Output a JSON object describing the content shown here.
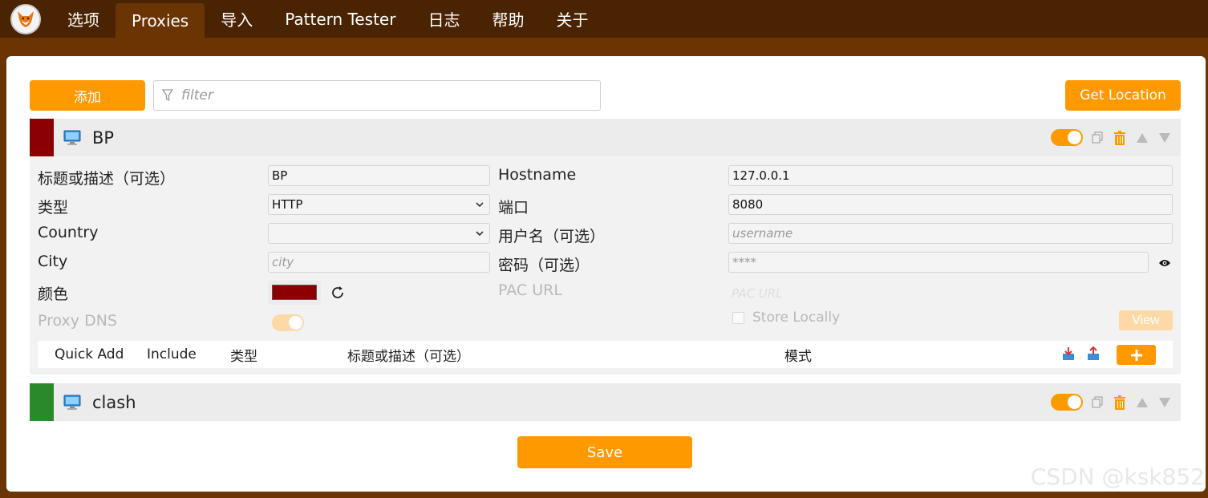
{
  "nav": {
    "tabs": [
      "选项",
      "Proxies",
      "导入",
      "Pattern Tester",
      "日志",
      "帮助",
      "关于"
    ],
    "active": "Proxies"
  },
  "toolbar": {
    "add_label": "添加",
    "filter_placeholder": "filter",
    "get_location_label": "Get Location"
  },
  "proxies": [
    {
      "title": "BP",
      "color": "#8b0000",
      "enabled": true,
      "expanded": true,
      "labels": {
        "title_desc": "标题或描述（可选）",
        "type": "类型",
        "country": "Country",
        "city": "City",
        "color": "颜色",
        "proxy_dns": "Proxy DNS",
        "hostname": "Hostname",
        "port": "端口",
        "username": "用户名（可选）",
        "password": "密码（可选）",
        "pac_url": "PAC URL",
        "store_locally": "Store Locally",
        "view": "View"
      },
      "values": {
        "title_desc": "BP",
        "type": "HTTP",
        "country": "",
        "city_placeholder": "city",
        "hostname": "127.0.0.1",
        "port": "8080",
        "username_placeholder": "username",
        "password_placeholder": "****",
        "pac_url_placeholder": "PAC URL"
      },
      "rules_header": {
        "quick_add": "Quick Add",
        "include": "Include",
        "type": "类型",
        "title": "标题或描述（可选）",
        "pattern": "模式"
      }
    },
    {
      "title": "clash",
      "color": "#2a8a2a",
      "enabled": true,
      "expanded": false
    }
  ],
  "save_label": "Save",
  "watermark": "CSDN @ksk852",
  "colors": {
    "accent": "#ff9900",
    "nav_bg": "#4a2302",
    "page_bg": "#6a3403"
  }
}
